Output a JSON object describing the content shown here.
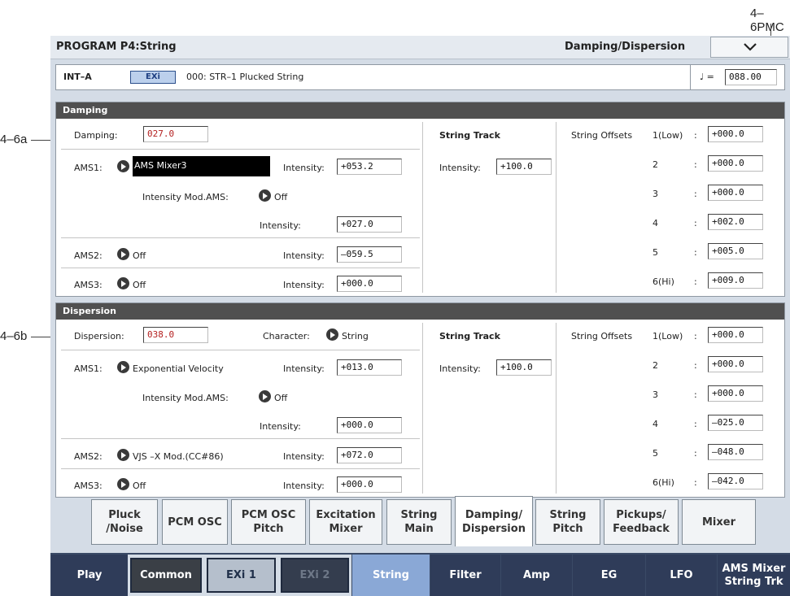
{
  "callouts": {
    "top": "4–6PMC",
    "a": "4–6a",
    "b": "4–6b"
  },
  "title": {
    "left": "PROGRAM P4:String",
    "right": "Damping/Dispersion"
  },
  "info": {
    "bank": "INT–A",
    "badge": "EXi",
    "program": "000: STR–1 Plucked String",
    "tempo_symbol": "♩ =",
    "tempo": "088.00"
  },
  "damping": {
    "header": "Damping",
    "label": "Damping:",
    "value": "027.0",
    "ams1": {
      "label": "AMS1:",
      "source": "AMS Mixer3",
      "int_label": "Intensity:",
      "int": "+053.2"
    },
    "mod": {
      "label": "Intensity Mod.AMS:",
      "source": "Off",
      "int_label": "Intensity:",
      "int": "+027.0"
    },
    "ams2": {
      "label": "AMS2:",
      "source": "Off",
      "int_label": "Intensity:",
      "int": "–059.5"
    },
    "ams3": {
      "label": "AMS3:",
      "source": "Off",
      "int_label": "Intensity:",
      "int": "+000.0"
    },
    "track": {
      "title": "String Track",
      "label": "Intensity:",
      "value": "+100.0"
    },
    "offsets": {
      "title": "String Offsets",
      "items": [
        {
          "name": "1(Low)",
          "value": "+000.0"
        },
        {
          "name": "2",
          "value": "+000.0"
        },
        {
          "name": "3",
          "value": "+000.0"
        },
        {
          "name": "4",
          "value": "+002.0"
        },
        {
          "name": "5",
          "value": "+005.0"
        },
        {
          "name": "6(Hi)",
          "value": "+009.0"
        }
      ]
    }
  },
  "dispersion": {
    "header": "Dispersion",
    "label": "Dispersion:",
    "value": "038.0",
    "char_label": "Character:",
    "character": "String",
    "ams1": {
      "label": "AMS1:",
      "source": "Exponential Velocity",
      "int_label": "Intensity:",
      "int": "+013.0"
    },
    "mod": {
      "label": "Intensity Mod.AMS:",
      "source": "Off",
      "int_label": "Intensity:",
      "int": "+000.0"
    },
    "ams2": {
      "label": "AMS2:",
      "source": "VJS –X Mod.(CC#86)",
      "int_label": "Intensity:",
      "int": "+072.0"
    },
    "ams3": {
      "label": "AMS3:",
      "source": "Off",
      "int_label": "Intensity:",
      "int": "+000.0"
    },
    "track": {
      "title": "String Track",
      "label": "Intensity:",
      "value": "+100.0"
    },
    "offsets": {
      "title": "String Offsets",
      "items": [
        {
          "name": "1(Low)",
          "value": "+000.0"
        },
        {
          "name": "2",
          "value": "+000.0"
        },
        {
          "name": "3",
          "value": "+000.0"
        },
        {
          "name": "4",
          "value": "–025.0"
        },
        {
          "name": "5",
          "value": "–048.0"
        },
        {
          "name": "6(Hi)",
          "value": "–042.0"
        }
      ]
    }
  },
  "page_tabs": [
    {
      "l1": "Pluck",
      "l2": "/Noise"
    },
    {
      "l1": "PCM OSC",
      "l2": ""
    },
    {
      "l1": "PCM OSC",
      "l2": "Pitch"
    },
    {
      "l1": "Excitation",
      "l2": "Mixer"
    },
    {
      "l1": "String",
      "l2": "Main"
    },
    {
      "l1": "Damping/",
      "l2": "Dispersion"
    },
    {
      "l1": "String",
      "l2": "Pitch"
    },
    {
      "l1": "Pickups/",
      "l2": "Feedback"
    },
    {
      "l1": "Mixer",
      "l2": ""
    }
  ],
  "bottom_tabs": [
    {
      "l1": "Play",
      "l2": ""
    },
    {
      "l1": "Common",
      "l2": ""
    },
    {
      "l1": "EXi 1",
      "l2": ""
    },
    {
      "l1": "EXi 2",
      "l2": ""
    },
    {
      "l1": "String",
      "l2": ""
    },
    {
      "l1": "Filter",
      "l2": ""
    },
    {
      "l1": "Amp",
      "l2": ""
    },
    {
      "l1": "EG",
      "l2": ""
    },
    {
      "l1": "LFO",
      "l2": ""
    },
    {
      "l1": "AMS Mixer",
      "l2": "String Trk"
    }
  ],
  "colors": {
    "accent_value": "#b42020",
    "tab_blue": "#8aa8d6",
    "tab_dark": "#2f3c59",
    "panel_header": "#505050"
  }
}
